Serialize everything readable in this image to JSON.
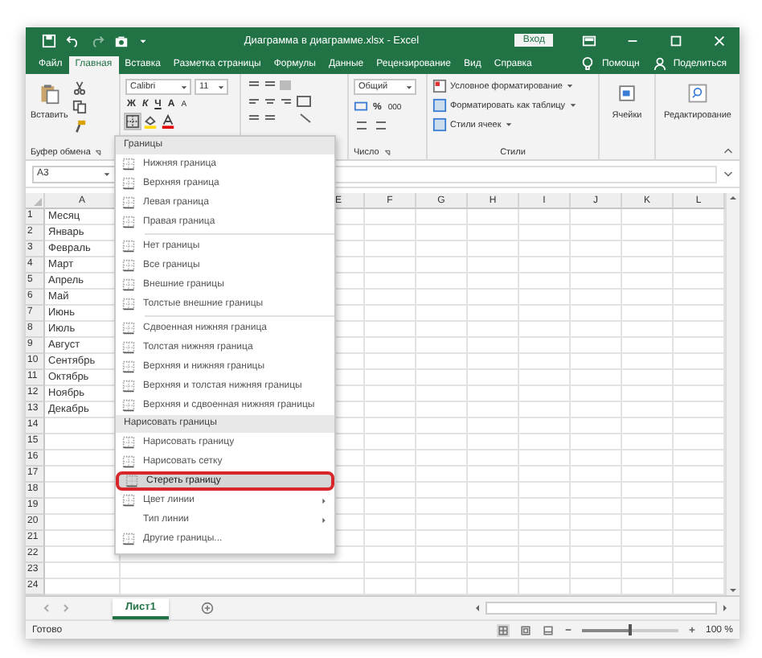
{
  "title_bar": {
    "title": "Диаграмма в диаграмме.xlsx  -  Excel",
    "login_button": "Вход"
  },
  "ribbon_tabs": [
    {
      "label": "Файл",
      "selected": false
    },
    {
      "label": "Главная",
      "selected": true
    },
    {
      "label": "Вставка",
      "selected": false
    },
    {
      "label": "Разметка страницы",
      "selected": false
    },
    {
      "label": "Формулы",
      "selected": false
    },
    {
      "label": "Данные",
      "selected": false
    },
    {
      "label": "Рецензирование",
      "selected": false
    },
    {
      "label": "Вид",
      "selected": false
    },
    {
      "label": "Справка",
      "selected": false
    }
  ],
  "tell_me": "Помощн",
  "share": "Поделиться",
  "ribbon": {
    "paste": "Вставить",
    "clipboard_label": "Буфер обмена",
    "font_name": "Calibri",
    "font_size": "11",
    "bold": "Ж",
    "italic": "К",
    "underline": "Ч",
    "grow_font": "A",
    "shrink_font": "A",
    "number_format": "Общий",
    "percent": "%",
    "thousands": "000",
    "number_label": "Число",
    "conditional_formatting": "Условное форматирование",
    "format_as_table": "Форматировать как таблицу",
    "cell_styles": "Стили ячеек",
    "styles_label": "Стили",
    "cells": "Ячейки",
    "editing": "Редактирование"
  },
  "name_box": "A3",
  "columns": [
    "A",
    "E",
    "F",
    "G",
    "H",
    "I",
    "J",
    "K",
    "L"
  ],
  "rows": [
    {
      "number": "1",
      "a": "Месяц"
    },
    {
      "number": "2",
      "a": "Январь"
    },
    {
      "number": "3",
      "a": "Февраль"
    },
    {
      "number": "4",
      "a": "Март"
    },
    {
      "number": "5",
      "a": "Апрель"
    },
    {
      "number": "6",
      "a": "Май"
    },
    {
      "number": "7",
      "a": "Июнь"
    },
    {
      "number": "8",
      "a": "Июль"
    },
    {
      "number": "9",
      "a": "Август"
    },
    {
      "number": "10",
      "a": "Сентябрь"
    },
    {
      "number": "11",
      "a": "Октябрь"
    },
    {
      "number": "12",
      "a": "Ноябрь"
    },
    {
      "number": "13",
      "a": "Декабрь"
    },
    {
      "number": "14"
    },
    {
      "number": "15"
    },
    {
      "number": "16"
    },
    {
      "number": "17"
    },
    {
      "number": "18"
    },
    {
      "number": "19"
    },
    {
      "number": "20"
    },
    {
      "number": "21"
    },
    {
      "number": "22"
    },
    {
      "number": "23"
    },
    {
      "number": "24"
    }
  ],
  "borders_menu": [
    {
      "kind": "header",
      "label": "Границы"
    },
    {
      "kind": "item",
      "label": "Нижняя граница",
      "selected": false,
      "icon": true,
      "submenu": false
    },
    {
      "kind": "item",
      "label": "Верхняя граница",
      "selected": false,
      "icon": true,
      "submenu": false
    },
    {
      "kind": "item",
      "label": "Левая граница",
      "selected": false,
      "icon": true,
      "submenu": false
    },
    {
      "kind": "item",
      "label": "Правая граница",
      "selected": false,
      "icon": true,
      "submenu": false
    },
    {
      "kind": "separator"
    },
    {
      "kind": "item",
      "label": "Нет границы",
      "selected": false,
      "icon": true,
      "submenu": false
    },
    {
      "kind": "item",
      "label": "Все границы",
      "selected": false,
      "icon": true,
      "submenu": false
    },
    {
      "kind": "item",
      "label": "Внешние границы",
      "selected": false,
      "icon": true,
      "submenu": false
    },
    {
      "kind": "item",
      "label": "Толстые внешние границы",
      "selected": false,
      "icon": true,
      "submenu": false
    },
    {
      "kind": "separator"
    },
    {
      "kind": "item",
      "label": "Сдвоенная нижняя граница",
      "selected": false,
      "icon": true,
      "submenu": false
    },
    {
      "kind": "item",
      "label": "Толстая нижняя граница",
      "selected": false,
      "icon": true,
      "submenu": false
    },
    {
      "kind": "item",
      "label": "Верхняя и нижняя границы",
      "selected": false,
      "icon": true,
      "submenu": false
    },
    {
      "kind": "item",
      "label": "Верхняя и толстая нижняя границы",
      "selected": false,
      "icon": true,
      "submenu": false
    },
    {
      "kind": "item",
      "label": "Верхняя и сдвоенная нижняя границы",
      "selected": false,
      "icon": true,
      "submenu": false
    },
    {
      "kind": "header",
      "label": "Нарисовать границы"
    },
    {
      "kind": "item",
      "label": "Нарисовать границу",
      "selected": false,
      "icon": true,
      "submenu": false
    },
    {
      "kind": "item",
      "label": "Нарисовать сетку",
      "selected": false,
      "icon": true,
      "submenu": false
    },
    {
      "kind": "item",
      "label": "Стереть границу",
      "selected": true,
      "icon": true,
      "submenu": false
    },
    {
      "kind": "item",
      "label": "Цвет линии",
      "selected": false,
      "icon": true,
      "submenu": true
    },
    {
      "kind": "item",
      "label": "Тип линии",
      "selected": false,
      "icon": false,
      "submenu": true
    },
    {
      "kind": "item",
      "label": "Другие границы...",
      "selected": false,
      "icon": true,
      "submenu": false
    }
  ],
  "sheet_tabs": [
    {
      "label": "Лист1",
      "selected": true
    }
  ],
  "status": "Готово",
  "zoom": {
    "level": 0.5,
    "reading": "100 %"
  }
}
